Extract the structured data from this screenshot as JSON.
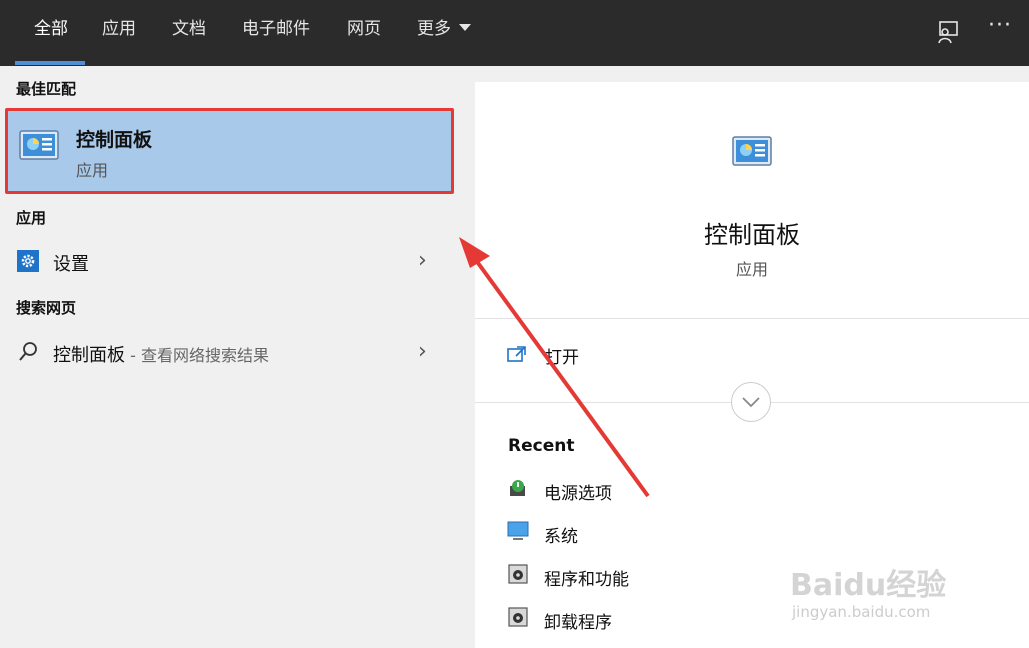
{
  "tabs": [
    {
      "label": "全部"
    },
    {
      "label": "应用"
    },
    {
      "label": "文档"
    },
    {
      "label": "电子邮件"
    },
    {
      "label": "网页"
    },
    {
      "label": "更多"
    }
  ],
  "toolbar": {
    "more_options": "···"
  },
  "left": {
    "best_match_title": "最佳匹配",
    "best_match": {
      "name": "控制面板",
      "type": "应用"
    },
    "apps_title": "应用",
    "apps": [
      {
        "label": "设置"
      }
    ],
    "web_title": "搜索网页",
    "web": [
      {
        "label": "控制面板",
        "suffix": " - 查看网络搜索结果"
      }
    ]
  },
  "right": {
    "title": "控制面板",
    "subtitle": "应用",
    "open_label": "打开",
    "recent_title": "Recent",
    "recent": [
      {
        "label": "电源选项",
        "icon": "power-options-icon"
      },
      {
        "label": "系统",
        "icon": "system-monitor-icon"
      },
      {
        "label": "程序和功能",
        "icon": "programs-icon"
      },
      {
        "label": "卸载程序",
        "icon": "uninstall-icon"
      }
    ]
  },
  "watermark": {
    "brand": "Baidu经验",
    "url": "jingyan.baidu.com"
  },
  "colors": {
    "highlight": "#a9c9ea",
    "annotation_red": "#e53935",
    "topbar": "#2b2b2b",
    "tab_accent": "#4f8fd6"
  }
}
